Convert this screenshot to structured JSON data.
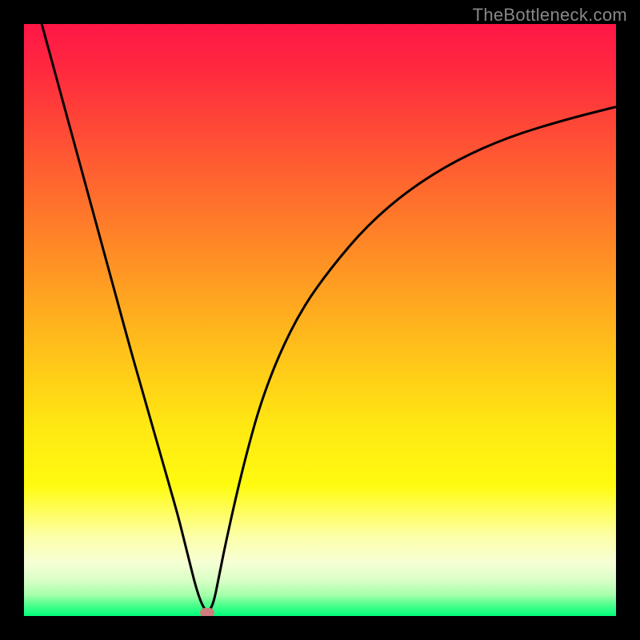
{
  "watermark": "TheBottleneck.com",
  "chart_data": {
    "type": "line",
    "title": "",
    "xlabel": "",
    "ylabel": "",
    "xlim": [
      0,
      100
    ],
    "ylim": [
      0,
      100
    ],
    "grid": false,
    "legend": false,
    "series": [
      {
        "name": "bottleneck-curve",
        "x": [
          3,
          6,
          9,
          12,
          15,
          18,
          20,
          22,
          24,
          26,
          27,
          28,
          29,
          30,
          31,
          32,
          33,
          34,
          36,
          38,
          40,
          43,
          47,
          52,
          58,
          65,
          73,
          82,
          92,
          100
        ],
        "y": [
          100,
          89,
          78,
          67,
          56,
          45,
          38,
          31,
          24,
          17,
          13,
          9,
          5,
          2,
          0.5,
          2,
          7,
          12,
          21,
          29,
          36,
          44,
          52,
          59,
          66,
          72,
          77,
          81,
          84,
          86
        ]
      }
    ],
    "marker": {
      "x": 31,
      "y": 0.5,
      "color": "#cf7d7d"
    },
    "gradient_stops": [
      {
        "pct": 0,
        "color": "#ff1647"
      },
      {
        "pct": 18,
        "color": "#ff4a36"
      },
      {
        "pct": 38,
        "color": "#ff8a26"
      },
      {
        "pct": 58,
        "color": "#ffca18"
      },
      {
        "pct": 78,
        "color": "#fffb10"
      },
      {
        "pct": 91,
        "color": "#f6ffd5"
      },
      {
        "pct": 96.5,
        "color": "#a4ffab"
      },
      {
        "pct": 100,
        "color": "#00ff7a"
      }
    ]
  }
}
